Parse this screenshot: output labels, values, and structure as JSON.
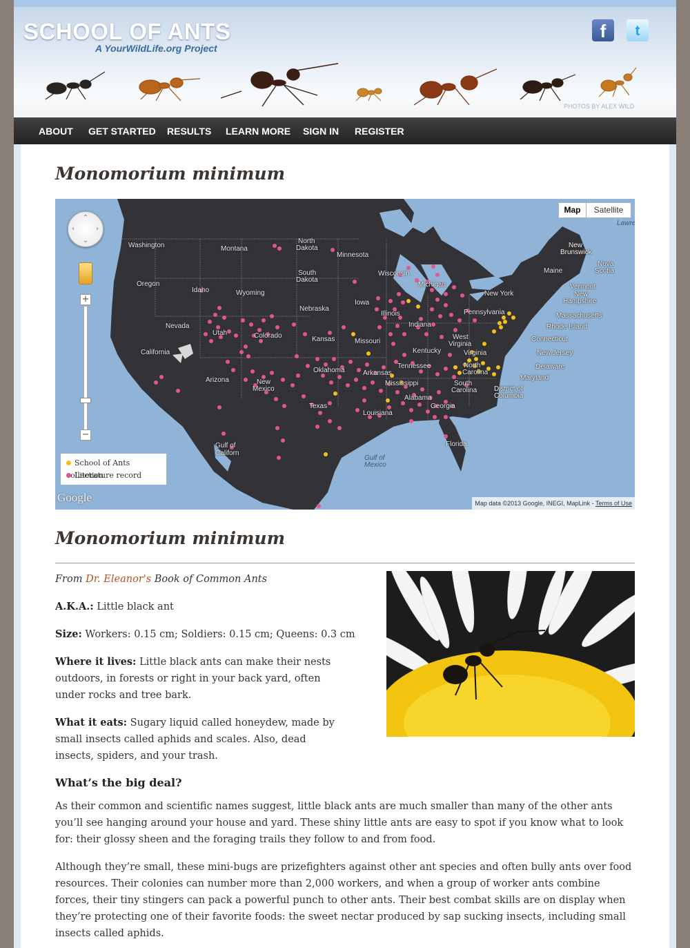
{
  "header": {
    "logo": "SCHOOL OF ANTS",
    "tagline": "A YourWildLife.org Project",
    "photo_credit": "PHOTOS BY ALEX WILD",
    "social": {
      "facebook_glyph": "f",
      "twitter_glyph": "t"
    }
  },
  "nav": {
    "items": [
      "ABOUT",
      "GET STARTED",
      "RESULTS",
      "LEARN MORE",
      "SIGN IN",
      "REGISTER"
    ]
  },
  "page": {
    "title": "Monomorium minimum",
    "section_title": "Monomorium minimum"
  },
  "map": {
    "type_controls": [
      "Map",
      "Satellite"
    ],
    "selected_type": "Map",
    "legend": [
      {
        "label": "School of Ants collection",
        "color": "#f2c21b"
      },
      {
        "label": "Literature record",
        "color": "#e2578f"
      }
    ],
    "logo_text": "Google",
    "attribution": "Map data ©2013 Google, INEGI, MapLink - ",
    "terms_link": "Terms of Use",
    "zoom_in": "+",
    "zoom_out": "−",
    "labels": {
      "washington": "Washington",
      "montana": "Montana",
      "north_dakota_1": "North",
      "north_dakota_2": "Dakota",
      "minnesota": "Minnesota",
      "south_dakota_1": "South",
      "south_dakota_2": "Dakota",
      "oregon": "Oregon",
      "idaho": "Idaho",
      "wyoming": "Wyoming",
      "wisconsin": "Wisconsin",
      "michigan": "Michigan",
      "iowa": "Iowa",
      "nebraska": "Nebraska",
      "nevada": "Nevada",
      "utah": "Utah",
      "colorado": "Colorado",
      "kansas": "Kansas",
      "missouri": "Missouri",
      "illinois": "Illinois",
      "indiana": "Indiana",
      "california": "California",
      "arizona": "Arizona",
      "new_mexico_1": "New",
      "new_mexico_2": "Mexico",
      "oklahoma": "Oklahoma",
      "arkansas": "Arkansas",
      "texas": "Texas",
      "louisiana": "Louisiana",
      "mississippi": "Mississippi",
      "alabama": "Alabama",
      "georgia": "Georgia",
      "tennessee": "Tennessee",
      "kentucky": "Kentucky",
      "west_virginia_1": "West",
      "west_virginia_2": "Virginia",
      "virginia": "Virginia",
      "north_carolina_1": "North",
      "north_carolina_2": "Carolina",
      "south_carolina_1": "South",
      "south_carolina_2": "Carolina",
      "pennsylvania": "Pennsylvania",
      "new_york": "New York",
      "maine": "Maine",
      "florida": "Florida",
      "vermont": "Vermont",
      "new_hampshire_1": "New",
      "new_hampshire_2": "Hampshire",
      "massachusetts": "Massachusetts",
      "rhode_island": "Rhode Island",
      "connecticut": "Connecticut",
      "new_jersey": "New Jersey",
      "delaware": "Delaware",
      "maryland": "Maryland",
      "dc_1": "District of",
      "dc_2": "Columbia",
      "new_brunswick_1": "New",
      "new_brunswick_2": "Brunswick",
      "nova_scotia_1": "Nova",
      "nova_scotia_2": "Scotia",
      "gulf_mexico_1": "Gulf of",
      "gulf_mexico_2": "Mexico",
      "gulf_california_1": "Gulf of",
      "gulf_california_2": "Californ",
      "lawrence": "Lawre"
    }
  },
  "book": {
    "from_prefix": "From ",
    "author_link": "Dr. Eleanor's",
    "book_title": " Book of Common Ants",
    "aka_label": "A.K.A.:",
    "aka_value": " Little black ant",
    "size_label": "Size:",
    "size_value": " Workers: 0.15 cm; Soldiers: 0.15 cm; Queens: 0.3 cm",
    "lives_label": "Where it lives:",
    "lives_value": " Little black ants can make their nests outdoors, in forests or right in your back yard, often under rocks and tree bark.",
    "eats_label": "What it eats:",
    "eats_value": " Sugary liquid called honeydew, made by small insects called aphids and scales. Also, dead insects, spiders, and your trash.",
    "big_deal_heading": "What’s the big deal?",
    "paragraph_1": "As their common and scientific names suggest, little black ants are much smaller than many of the other ants you’ll see hanging around your house and yard. These shiny little ants are easy to spot if you know what to look for: their glossy sheen and the foraging trails they follow to and from food.",
    "paragraph_2": "Although they’re small, these mini-bugs are prizefighters against other ant species and often bully ants over food resources. Their colonies can number more than 2,000 workers, and when a group of worker ants combine forces, their tiny stingers can pack a powerful punch to other ants. Their best combat skills are on display when they’re protecting one of their favorite foods: the sweet nectar produced by sap sucking insects, including small insects called aphids."
  }
}
